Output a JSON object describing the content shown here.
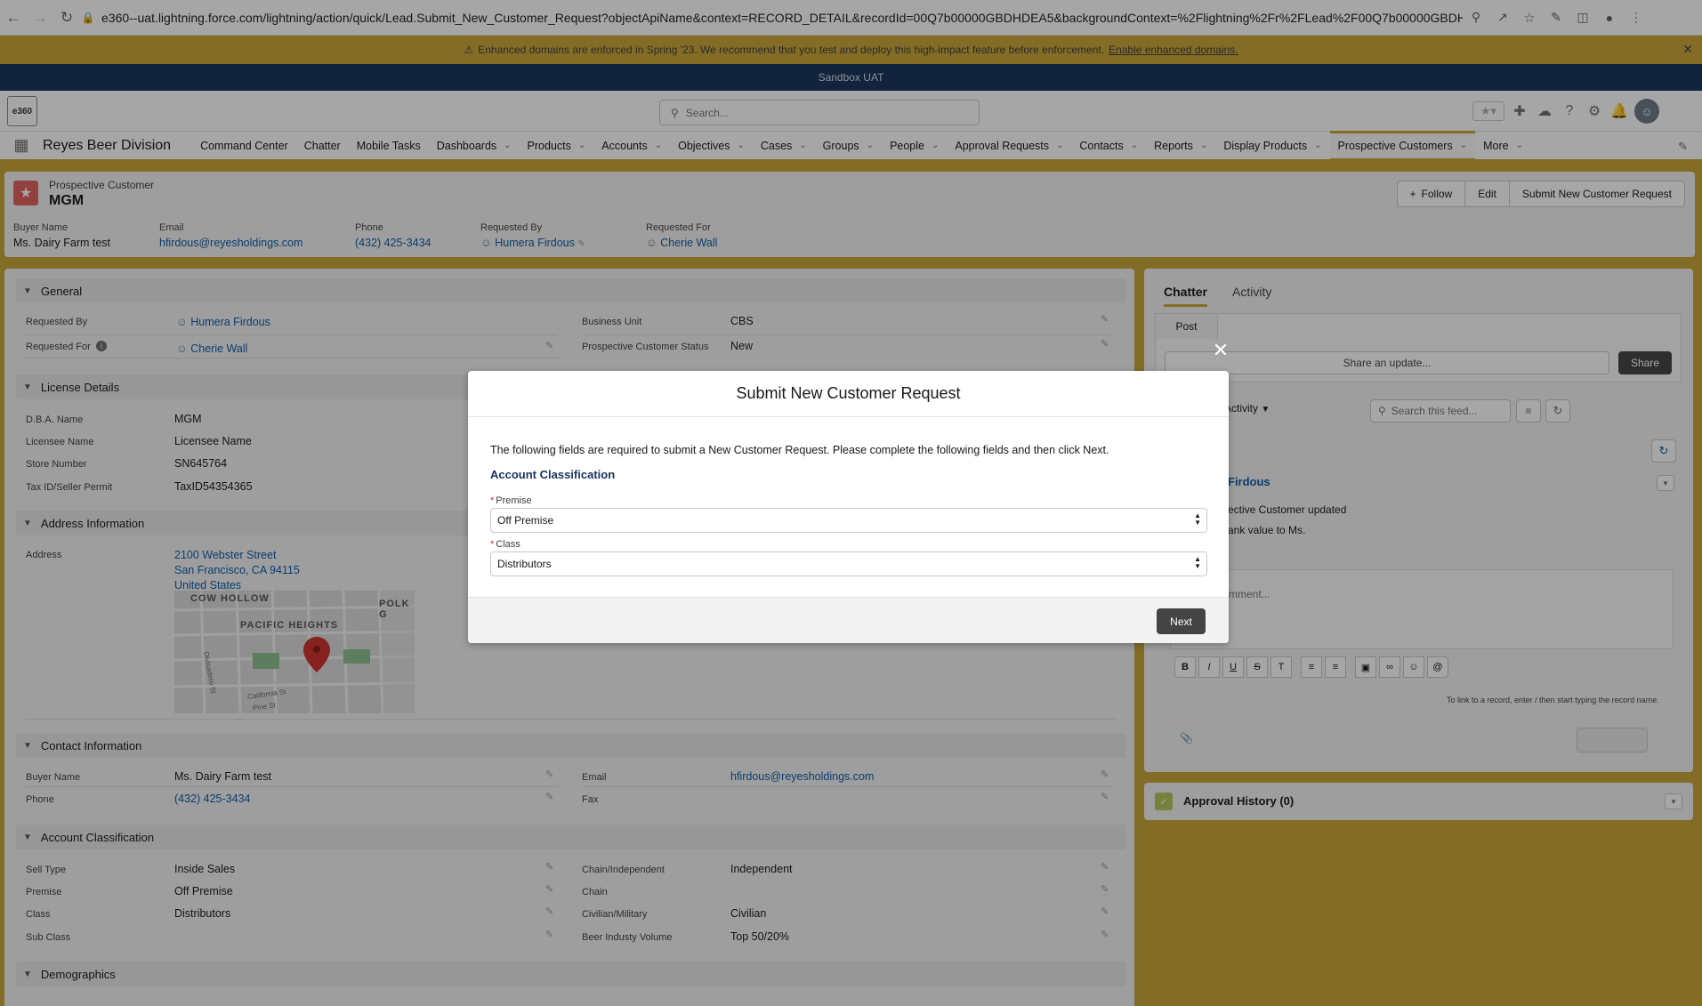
{
  "browser": {
    "url": "e360--uat.lightning.force.com/lightning/action/quick/Lead.Submit_New_Customer_Request?objectApiName&context=RECORD_DETAIL&recordId=00Q7b00000GBDHDEA5&backgroundContext=%2Flightning%2Fr%2FLead%2F00Q7b00000GBDHDE..."
  },
  "banner": {
    "text": "Enhanced domains are enforced in Spring '23. We recommend that you test and deploy this high-impact feature before enforcement.",
    "link": "Enable enhanced domains."
  },
  "sandbox": "Sandbox UAT",
  "header": {
    "logo": "e360",
    "search_placeholder": "Search..."
  },
  "nav": {
    "app_name": "Reyes Beer Division",
    "items": [
      {
        "label": "Command Center",
        "dropdown": false
      },
      {
        "label": "Chatter",
        "dropdown": false
      },
      {
        "label": "Mobile Tasks",
        "dropdown": false
      },
      {
        "label": "Dashboards",
        "dropdown": true
      },
      {
        "label": "Products",
        "dropdown": true
      },
      {
        "label": "Accounts",
        "dropdown": true
      },
      {
        "label": "Objectives",
        "dropdown": true
      },
      {
        "label": "Cases",
        "dropdown": true
      },
      {
        "label": "Groups",
        "dropdown": true
      },
      {
        "label": "People",
        "dropdown": true
      },
      {
        "label": "Approval Requests",
        "dropdown": true
      },
      {
        "label": "Contacts",
        "dropdown": true
      },
      {
        "label": "Reports",
        "dropdown": true
      },
      {
        "label": "Display Products",
        "dropdown": true
      },
      {
        "label": "Prospective Customers",
        "dropdown": true,
        "active": true
      },
      {
        "label": "More",
        "dropdown": true
      }
    ]
  },
  "record": {
    "type": "Prospective Customer",
    "name": "MGM",
    "buttons": {
      "follow": "Follow",
      "edit": "Edit",
      "submit": "Submit New Customer Request"
    },
    "highlights": {
      "buyer_label": "Buyer Name",
      "buyer": "Ms. Dairy Farm test",
      "email_label": "Email",
      "email": "hfirdous@reyesholdings.com",
      "phone_label": "Phone",
      "phone": "(432) 425-3434",
      "reqby_label": "Requested By",
      "reqby": "Humera Firdous",
      "reqfor_label": "Requested For",
      "reqfor": "Cherie Wall"
    }
  },
  "details": {
    "general": {
      "title": "General",
      "requested_by_label": "Requested By",
      "requested_by": "Humera Firdous",
      "requested_for_label": "Requested For",
      "requested_for": "Cherie Wall",
      "business_unit_label": "Business Unit",
      "business_unit": "CBS",
      "status_label": "Prospective Customer Status",
      "status": "New"
    },
    "license": {
      "title": "License Details",
      "dba_label": "D.B.A. Name",
      "dba": "MGM",
      "licensee_label": "Licensee Name",
      "licensee": "Licensee Name",
      "store_label": "Store Number",
      "store": "SN645764",
      "tax_label": "Tax ID/Seller Permit",
      "tax": "TaxID54354365"
    },
    "address": {
      "title": "Address Information",
      "address_label": "Address",
      "line1": "2100 Webster Street",
      "line2": "San Francisco, CA 94115",
      "line3": "United States",
      "map_labels": [
        "COW HOLLOW",
        "PACIFIC HEIGHTS",
        "POLK G",
        "Divisadero St",
        "California St",
        "Pine St"
      ]
    },
    "contact": {
      "title": "Contact Information",
      "buyer_label": "Buyer Name",
      "buyer": "Ms. Dairy Farm test",
      "phone_label": "Phone",
      "phone": "(432) 425-3434",
      "email_label": "Email",
      "email": "hfirdous@reyesholdings.com",
      "fax_label": "Fax"
    },
    "classification": {
      "title": "Account Classification",
      "sell_type_label": "Sell Type",
      "sell_type": "Inside Sales",
      "premise_label": "Premise",
      "premise": "Off Premise",
      "class_label": "Class",
      "class": "Distributors",
      "subclass_label": "Sub Class",
      "chain_ind_label": "Chain/Independent",
      "chain_ind": "Independent",
      "chain_label": "Chain",
      "civ_label": "Civilian/Military",
      "civ": "Civilian",
      "beer_label": "Beer Industy Volume",
      "beer": "Top 50/20%"
    },
    "demographics": {
      "title": "Demographics"
    }
  },
  "chatter": {
    "tabs": [
      "Chatter",
      "Activity"
    ],
    "post_tab": "Post",
    "share_placeholder": "Share an update...",
    "share_button": "Share",
    "filter": "Activity",
    "search_placeholder": "Search this feed...",
    "feed_name": "Firdous",
    "feed_line1": "ective Customer updated",
    "feed_line2": "ank value to Ms.",
    "comment_placeholder": "mment...",
    "hint": "To link to a record, enter / then start typing the record name."
  },
  "approval": {
    "title": "Approval History (0)"
  },
  "modal": {
    "title": "Submit New Customer Request",
    "instructions": "The following fields are required to submit a New Customer Request. Please complete the following fields and then click Next.",
    "section": "Account Classification",
    "premise_label": "Premise",
    "premise_value": "Off Premise",
    "class_label": "Class",
    "class_value": "Distributors",
    "next": "Next"
  }
}
